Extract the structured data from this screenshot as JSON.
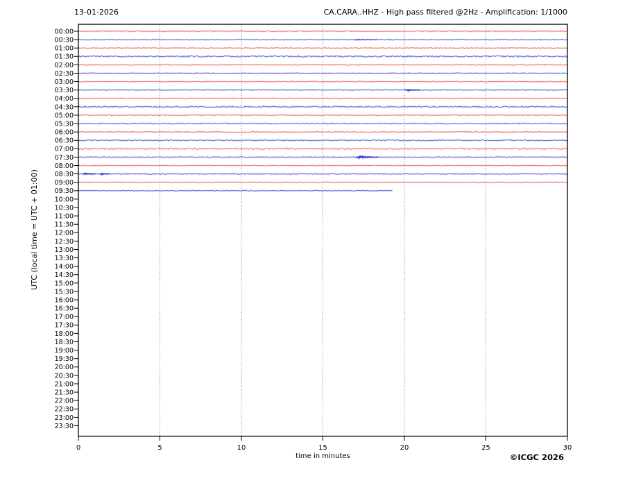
{
  "header": {
    "date": "13-01-2026",
    "title": "CA.CARA..HHZ - High pass filtered @2Hz - Amplification: 1/1000"
  },
  "y_axis_label": "UTC (local time = UTC + 01:00)",
  "footer": {
    "xlabel": "time in minutes",
    "copyright": "©ICGC 2026"
  },
  "colors": {
    "trace_red": "#ee6a6a",
    "trace_blue": "#5a5ae0",
    "event_blue": "#2424cc",
    "grid": "#606060",
    "axis": "#000000"
  },
  "chart_data": {
    "type": "line",
    "subtype": "helicorder",
    "station": "CA.CARA..HHZ",
    "filter": "High pass filtered @2Hz",
    "amplification": "1/1000",
    "x_range": [
      0,
      30
    ],
    "x_ticks": [
      0,
      5,
      10,
      15,
      20,
      25,
      30
    ],
    "grid_minutes": [
      5,
      10,
      15,
      20,
      25
    ],
    "minutes_per_row": 30,
    "rows": [
      {
        "label": "00:00",
        "color": "red",
        "end": 30,
        "noise": 0.55,
        "events": []
      },
      {
        "label": "00:30",
        "color": "blue",
        "end": 30,
        "noise": 0.5,
        "events": [
          {
            "start": 16.9,
            "end": 18.3,
            "amp": 0.55,
            "intensity": 0.55
          }
        ]
      },
      {
        "label": "01:00",
        "color": "red",
        "end": 30,
        "noise": 0.45,
        "events": []
      },
      {
        "label": "01:30",
        "color": "blue",
        "end": 30,
        "noise": 0.95,
        "events": []
      },
      {
        "label": "02:00",
        "color": "red",
        "end": 30,
        "noise": 0.7,
        "events": []
      },
      {
        "label": "02:30",
        "color": "blue",
        "end": 30,
        "noise": 0.45,
        "events": []
      },
      {
        "label": "03:00",
        "color": "red",
        "end": 30,
        "noise": 0.5,
        "events": []
      },
      {
        "label": "03:30",
        "color": "blue",
        "end": 30,
        "noise": 0.5,
        "events": [
          {
            "start": 20.05,
            "end": 20.95,
            "amp": 1.0,
            "intensity": 1
          }
        ]
      },
      {
        "label": "04:00",
        "color": "red",
        "end": 30,
        "noise": 0.55,
        "events": []
      },
      {
        "label": "04:30",
        "color": "blue",
        "end": 30,
        "noise": 0.85,
        "events": []
      },
      {
        "label": "05:00",
        "color": "red",
        "end": 30,
        "noise": 0.5,
        "events": []
      },
      {
        "label": "05:30",
        "color": "blue",
        "end": 30,
        "noise": 0.7,
        "events": []
      },
      {
        "label": "06:00",
        "color": "red",
        "end": 30,
        "noise": 0.6,
        "events": []
      },
      {
        "label": "06:30",
        "color": "blue",
        "end": 30,
        "noise": 0.7,
        "events": []
      },
      {
        "label": "07:00",
        "color": "red",
        "end": 30,
        "noise": 0.9,
        "events": []
      },
      {
        "label": "07:30",
        "color": "blue",
        "end": 30,
        "noise": 0.6,
        "events": [
          {
            "start": 17.0,
            "end": 18.4,
            "amp": 1.7,
            "intensity": 1
          }
        ]
      },
      {
        "label": "08:00",
        "color": "red",
        "end": 30,
        "noise": 0.5,
        "events": []
      },
      {
        "label": "08:30",
        "color": "blue",
        "end": 30,
        "noise": 0.6,
        "events": [
          {
            "start": 0.25,
            "end": 1.05,
            "amp": 1.2,
            "intensity": 1
          },
          {
            "start": 1.3,
            "end": 1.9,
            "amp": 1.0,
            "intensity": 1
          }
        ]
      },
      {
        "label": "09:00",
        "color": "red",
        "end": 30,
        "noise": 0.55,
        "events": []
      },
      {
        "label": "09:30",
        "color": "blue",
        "end": 19.3,
        "noise": 0.5,
        "events": []
      },
      {
        "label": "10:00",
        "color": "red",
        "end": null,
        "events": []
      },
      {
        "label": "10:30",
        "color": "blue",
        "end": null,
        "events": []
      },
      {
        "label": "11:00",
        "color": "red",
        "end": null,
        "events": []
      },
      {
        "label": "11:30",
        "color": "blue",
        "end": null,
        "events": []
      },
      {
        "label": "12:00",
        "color": "red",
        "end": null,
        "events": []
      },
      {
        "label": "12:30",
        "color": "blue",
        "end": null,
        "events": []
      },
      {
        "label": "13:00",
        "color": "red",
        "end": null,
        "events": []
      },
      {
        "label": "13:30",
        "color": "blue",
        "end": null,
        "events": []
      },
      {
        "label": "14:00",
        "color": "red",
        "end": null,
        "events": []
      },
      {
        "label": "14:30",
        "color": "blue",
        "end": null,
        "events": []
      },
      {
        "label": "15:00",
        "color": "red",
        "end": null,
        "events": []
      },
      {
        "label": "15:30",
        "color": "blue",
        "end": null,
        "events": []
      },
      {
        "label": "16:00",
        "color": "red",
        "end": null,
        "events": []
      },
      {
        "label": "16:30",
        "color": "blue",
        "end": null,
        "events": []
      },
      {
        "label": "17:00",
        "color": "red",
        "end": null,
        "events": []
      },
      {
        "label": "17:30",
        "color": "blue",
        "end": null,
        "events": []
      },
      {
        "label": "18:00",
        "color": "red",
        "end": null,
        "events": []
      },
      {
        "label": "18:30",
        "color": "blue",
        "end": null,
        "events": []
      },
      {
        "label": "19:00",
        "color": "red",
        "end": null,
        "events": []
      },
      {
        "label": "19:30",
        "color": "blue",
        "end": null,
        "events": []
      },
      {
        "label": "20:00",
        "color": "red",
        "end": null,
        "events": []
      },
      {
        "label": "20:30",
        "color": "blue",
        "end": null,
        "events": []
      },
      {
        "label": "21:00",
        "color": "red",
        "end": null,
        "events": []
      },
      {
        "label": "21:30",
        "color": "blue",
        "end": null,
        "events": []
      },
      {
        "label": "22:00",
        "color": "red",
        "end": null,
        "events": []
      },
      {
        "label": "22:30",
        "color": "blue",
        "end": null,
        "events": []
      },
      {
        "label": "23:00",
        "color": "red",
        "end": null,
        "events": []
      },
      {
        "label": "23:30",
        "color": "blue",
        "end": null,
        "events": []
      }
    ]
  }
}
